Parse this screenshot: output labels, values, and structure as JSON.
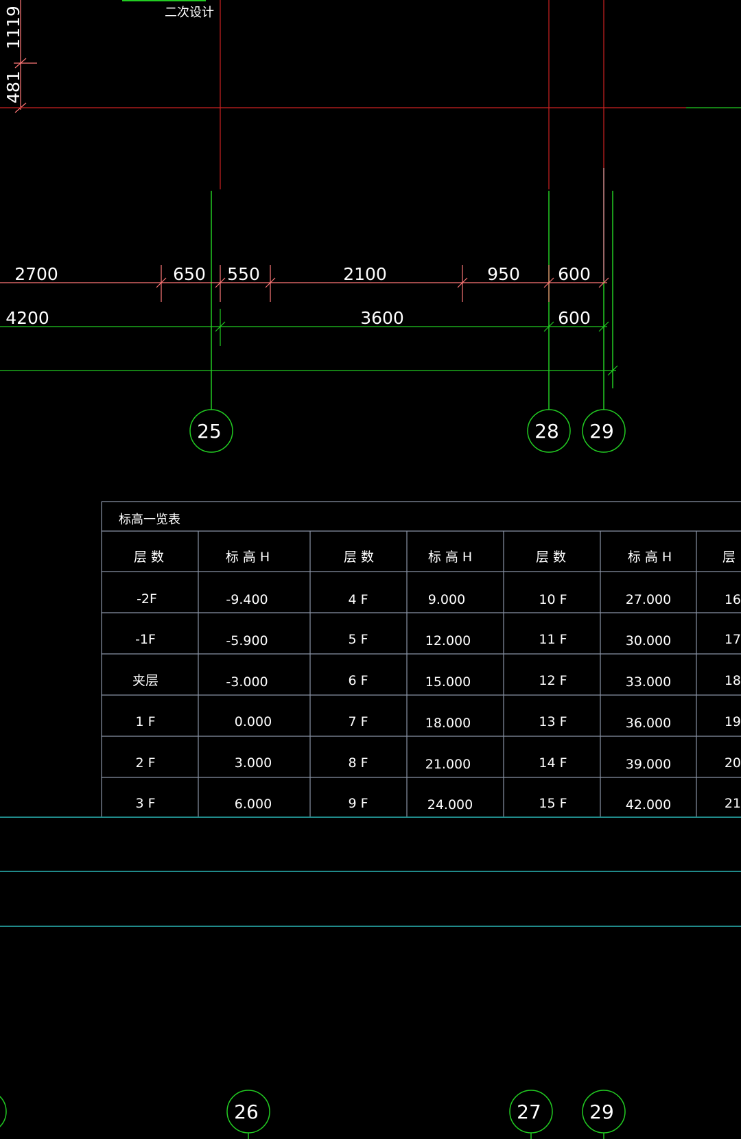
{
  "top_label": "二次设计",
  "side_dimensions": [
    "1119",
    "481"
  ],
  "dimensions": {
    "upper_row": [
      "2700",
      "650",
      "550",
      "2100",
      "950",
      "600"
    ],
    "lower_row": [
      "4200",
      "3600",
      "600"
    ]
  },
  "axis_labels": {
    "upper": [
      "25",
      "28",
      "29"
    ],
    "lower": [
      "26",
      "27",
      "29"
    ]
  },
  "elevation_table": {
    "title": "标高一览表",
    "headers": [
      "层 数",
      "标 高 H",
      "层 数",
      "标 高 H",
      "层 数",
      "标 高 H",
      "层"
    ],
    "rows": [
      [
        "-2F",
        "-9.400",
        "4 F",
        "9.000",
        "10 F",
        "27.000",
        "16"
      ],
      [
        "-1F",
        "-5.900",
        "5 F",
        "12.000",
        "11 F",
        "30.000",
        "17"
      ],
      [
        "夹层",
        "-3.000",
        "6 F",
        "15.000",
        "12 F",
        "33.000",
        "18"
      ],
      [
        "1 F",
        "0.000",
        "7 F",
        "18.000",
        "13 F",
        "36.000",
        "19"
      ],
      [
        "2 F",
        "3.000",
        "8 F",
        "21.000",
        "14 F",
        "39.000",
        "20"
      ],
      [
        "3 F",
        "6.000",
        "9 F",
        "24.000",
        "15 F",
        "42.000",
        "21"
      ]
    ]
  },
  "colors": {
    "background": "#000000",
    "grid_line": "#cc2222",
    "dimension_line": "#ff7777",
    "axis_line": "#22cc22",
    "table_line": "#8a94a6",
    "baseline": "#33dddd",
    "text": "#ffffff"
  }
}
